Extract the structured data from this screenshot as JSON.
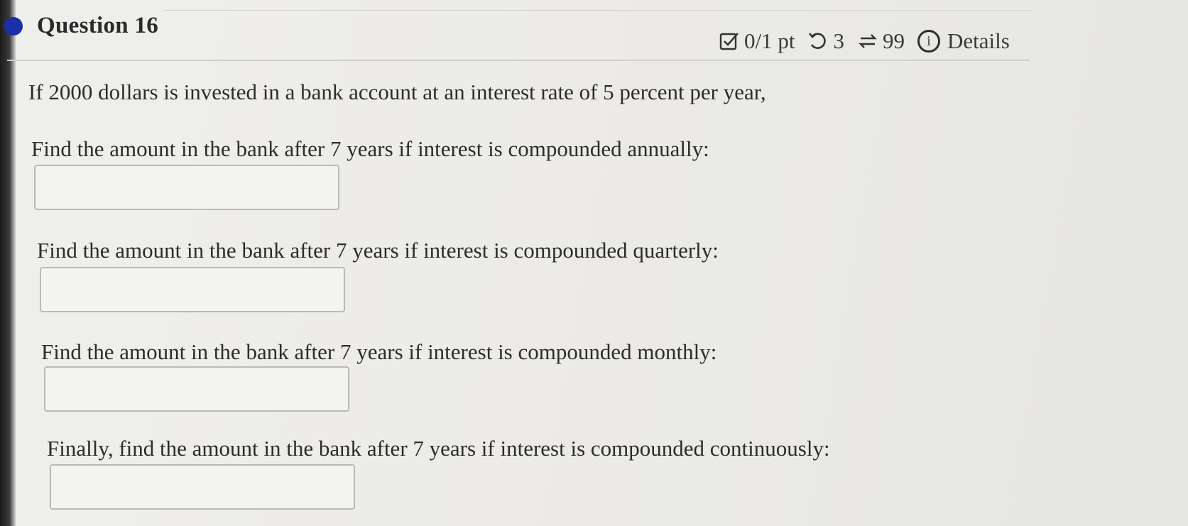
{
  "question": {
    "title": "Question 16",
    "score": "0/1 pt",
    "retries": "3",
    "attempts": "99",
    "details_label": "Details"
  },
  "prompt": "If 2000 dollars is invested in a bank account at an interest rate of 5 percent per year,",
  "parts": [
    {
      "label": "Find the amount in the bank after 7 years if interest is compounded annually:",
      "value": ""
    },
    {
      "label": "Find the amount in the bank after 7 years if interest is compounded quarterly:",
      "value": ""
    },
    {
      "label": "Find the amount in the bank after 7 years if interest is compounded monthly:",
      "value": ""
    },
    {
      "label": "Finally, find the amount in the bank after 7 years if interest is compounded continuously:",
      "value": ""
    }
  ],
  "icons": {
    "status": "blue-dot-icon",
    "score": "checkbox-icon",
    "retry": "retry-icon",
    "attempts": "repeat-icon",
    "details": "info-icon"
  },
  "colors": {
    "accent": "#1a2fa8"
  }
}
